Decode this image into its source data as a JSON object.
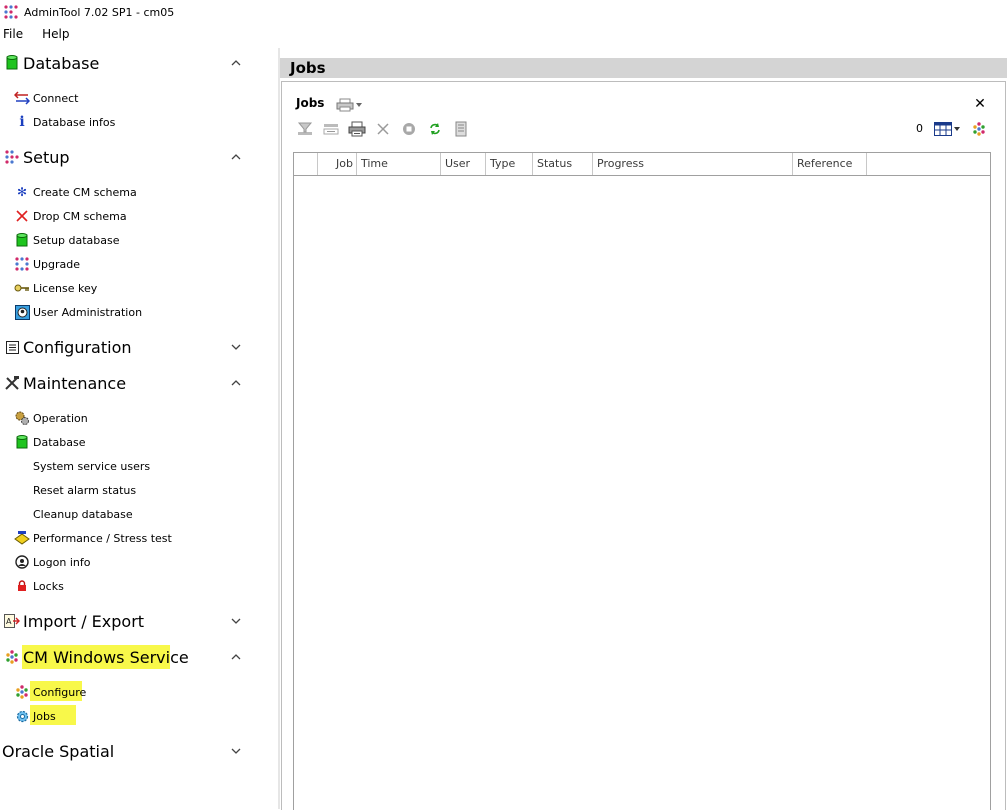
{
  "window": {
    "title": "AdminTool 7.02 SP1 - cm05"
  },
  "menu": [
    "File",
    "Help"
  ],
  "sidebar": {
    "database": {
      "label": "Database",
      "items": [
        "Connect",
        "Database infos"
      ]
    },
    "setup": {
      "label": "Setup",
      "items": [
        "Create CM schema",
        "Drop CM schema",
        "Setup database",
        "Upgrade",
        "License key",
        "User Administration"
      ]
    },
    "configuration": {
      "label": "Configuration"
    },
    "maintenance": {
      "label": "Maintenance",
      "items": [
        "Operation",
        "Database",
        "System service users",
        "Reset alarm status",
        "Cleanup database",
        "Performance / Stress test",
        "Logon info",
        "Locks"
      ]
    },
    "import_export": {
      "label": "Import / Export"
    },
    "cm_service": {
      "label": "CM Windows Service",
      "items": [
        "Configure",
        "Jobs"
      ]
    },
    "oracle": {
      "label": "Oracle Spatial"
    }
  },
  "panel": {
    "header": "Jobs",
    "title": "Jobs",
    "count": "0",
    "columns": [
      "Job",
      "Time",
      "User",
      "Type",
      "Status",
      "Progress",
      "Reference"
    ]
  },
  "colors": {
    "highlight": "#f8f84a",
    "header_bg": "#d4d4d4"
  }
}
